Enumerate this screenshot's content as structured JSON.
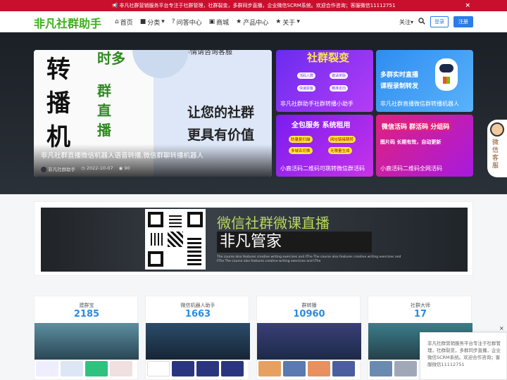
{
  "notice": {
    "text": "非凡社群营销服务平台专注于社群管理，社群裂变，多群同步直播，企业微信SCRM系统。欢迎合作咨询；客服微信11112751",
    "close": "×"
  },
  "header": {
    "logo": "非凡社群助手",
    "nav": [
      {
        "icon": "home-icon",
        "glyph": "⌂",
        "label": "首页"
      },
      {
        "icon": "folder-icon",
        "glyph": "■",
        "label": "分类",
        "caret": "▾"
      },
      {
        "icon": "question-icon",
        "glyph": "?",
        "label": "问答中心"
      },
      {
        "icon": "cart-icon",
        "glyph": "▣",
        "label": "商城"
      },
      {
        "icon": "star-icon",
        "glyph": "★",
        "label": "产品中心"
      },
      {
        "icon": "star-icon",
        "glyph": "★",
        "label": "关于",
        "caret": "▾"
      }
    ],
    "follow": "关注",
    "follow_caret": "▾",
    "login": "登录",
    "register": "注册"
  },
  "hero": {
    "big": {
      "chars": [
        "转",
        "播",
        "机"
      ],
      "green_chars": [
        "时多",
        "群",
        "直",
        "播"
      ],
      "slogans": [
        "让您的社群",
        "更具有价值"
      ],
      "top_text": "详情请咨询客服",
      "title": "非凡社群直播微信机器人语音转播,微信群聊转播机器人",
      "author": "非凡社群助手",
      "date": "2022-10-07",
      "views": "90"
    },
    "cards": [
      {
        "headline": "社群裂变",
        "pills": [
          "活码入群",
          "邀请奖励",
          "快速获客",
          "精准定向"
        ],
        "title": "非凡社群助手社群转播小助手",
        "color1": "#6a2cf0",
        "color2": "#b53cf5"
      },
      {
        "headline": "多群实时直播",
        "sub": "课程录制转发",
        "title": "非凡社群直播微信群转播机器人",
        "color1": "#2f8df0",
        "color2": "#59b2fb"
      },
      {
        "headline": "全包服务 系统租用",
        "pills": [
          "防量复扫描",
          "网址链接跳转",
          "多域名切换",
          "无限量生成"
        ],
        "title": "小鹿活码二维码可跳转微信群活码",
        "color1": "#7a1cf0",
        "color2": "#c733e8"
      },
      {
        "headline": "微信活码 群活码 分组码",
        "sub": "图片码 长期有效，自动更新",
        "title": "小鹿活码二维码全网活码",
        "color1": "#e0217e",
        "color2": "#a71ae0"
      }
    ]
  },
  "cs": {
    "label": "微信客服"
  },
  "banner": {
    "title": "微信社群微课直播",
    "subtitle": "非凡管家",
    "small": "The course also features creative writing exercises and tThe The course also features creative writing exercises and tThe The course also features creative writing exercises and tThe"
  },
  "stats": [
    {
      "label": "建群宝",
      "value": "2185"
    },
    {
      "label": "微信机器人助手",
      "value": "1663"
    },
    {
      "label": "群转播",
      "value": "10960"
    },
    {
      "label": "社群大师",
      "value": "17"
    }
  ],
  "popup": {
    "text": "非凡社群营销服务平台专注于社群管理，社群裂变，多群同步直播，企业微信SCRM系统。欢迎合作咨询；客服微信11112751",
    "close": "×"
  }
}
